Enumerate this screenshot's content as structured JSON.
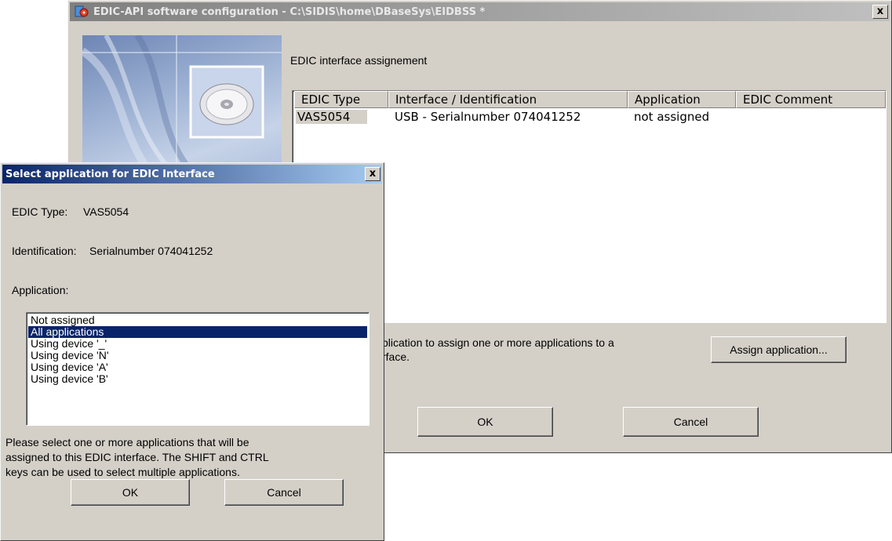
{
  "main_window": {
    "title": "EDIC-API software configuration - C:\\SIDIS\\home\\DBaseSys\\EIDBSS *",
    "close_label": "x",
    "section_label": "EDIC interface assignement",
    "table": {
      "headers": [
        "EDIC Type",
        "Interface / Identification",
        "Application",
        "EDIC Comment"
      ],
      "rows": [
        {
          "edic_type": "VAS5054",
          "interface": "USB - Serialnumber 074041252",
          "application": "not assigned",
          "comment": ""
        }
      ]
    },
    "hint_line1": "plication to assign one or more applications to a",
    "hint_line2": "rface.",
    "assign_button": "Assign application...",
    "ok_button": "OK",
    "cancel_button": "Cancel"
  },
  "dialog": {
    "title": "Select application for EDIC Interface",
    "close_label": "x",
    "edic_type_label": "EDIC Type:",
    "edic_type_value": "VAS5054",
    "identification_label": "Identification:",
    "identification_value": "Serialnumber 074041252",
    "application_label": "Application:",
    "applications": [
      "Not assigned",
      "All applications",
      "Using device '_'",
      "Using device 'N'",
      "Using device 'A'",
      "Using device 'B'"
    ],
    "selected_application": "All applications",
    "help_line1": "Please select one or more applications that will be",
    "help_line2": "assigned to this EDIC interface. The SHIFT and CTRL",
    "help_line3": "keys can be used to select multiple applications.",
    "ok_button": "OK",
    "cancel_button": "Cancel"
  },
  "colors": {
    "dialog_title_bg": "#0a246a",
    "main_title_bg": "#808080",
    "selection_bg": "#0a246a",
    "face": "#d4d0c8"
  }
}
